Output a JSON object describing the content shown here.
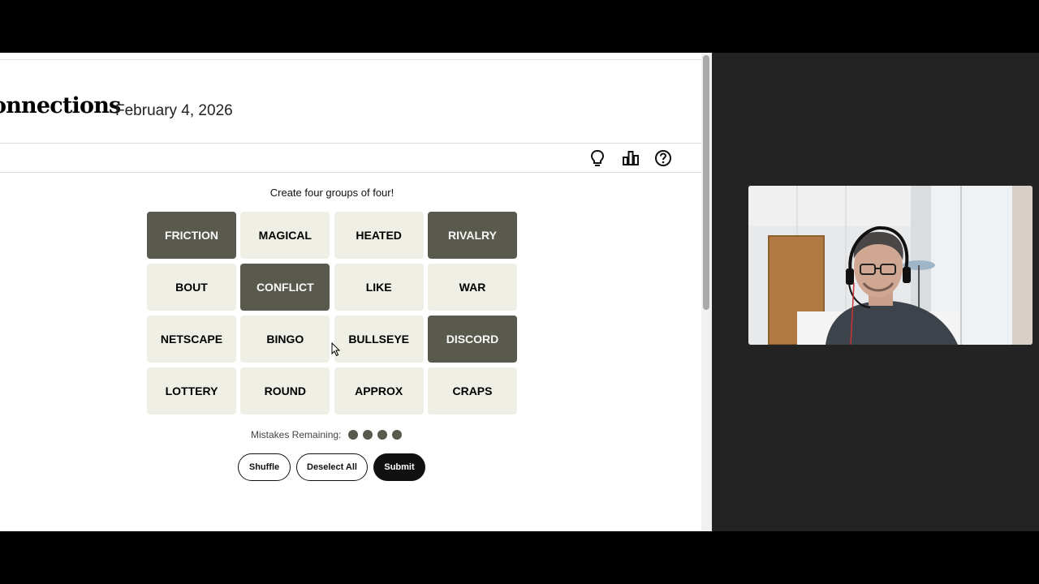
{
  "header": {
    "title": "onnections",
    "date": "February 4, 2026"
  },
  "toolbar": {
    "icons": [
      "lightbulb-icon",
      "stats-icon",
      "help-icon"
    ]
  },
  "game": {
    "instructions": "Create four groups of four!",
    "tiles": [
      {
        "label": "FRICTION",
        "selected": true
      },
      {
        "label": "MAGICAL",
        "selected": false
      },
      {
        "label": "HEATED",
        "selected": false
      },
      {
        "label": "RIVALRY",
        "selected": true
      },
      {
        "label": "BOUT",
        "selected": false
      },
      {
        "label": "CONFLICT",
        "selected": true
      },
      {
        "label": "LIKE",
        "selected": false
      },
      {
        "label": "WAR",
        "selected": false
      },
      {
        "label": "NETSCAPE",
        "selected": false
      },
      {
        "label": "BINGO",
        "selected": false
      },
      {
        "label": "BULLSEYE",
        "selected": false
      },
      {
        "label": "DISCORD",
        "selected": true
      },
      {
        "label": "LOTTERY",
        "selected": false
      },
      {
        "label": "ROUND",
        "selected": false
      },
      {
        "label": "APPROX",
        "selected": false
      },
      {
        "label": "CRAPS",
        "selected": false
      }
    ],
    "mistakes_label": "Mistakes Remaining:",
    "mistakes_remaining": 4,
    "buttons": {
      "shuffle": "Shuffle",
      "deselect": "Deselect All",
      "submit": "Submit"
    }
  },
  "colors": {
    "tile_default": "#efefe6",
    "tile_selected": "#5a594e",
    "background_panel": "#232323"
  }
}
